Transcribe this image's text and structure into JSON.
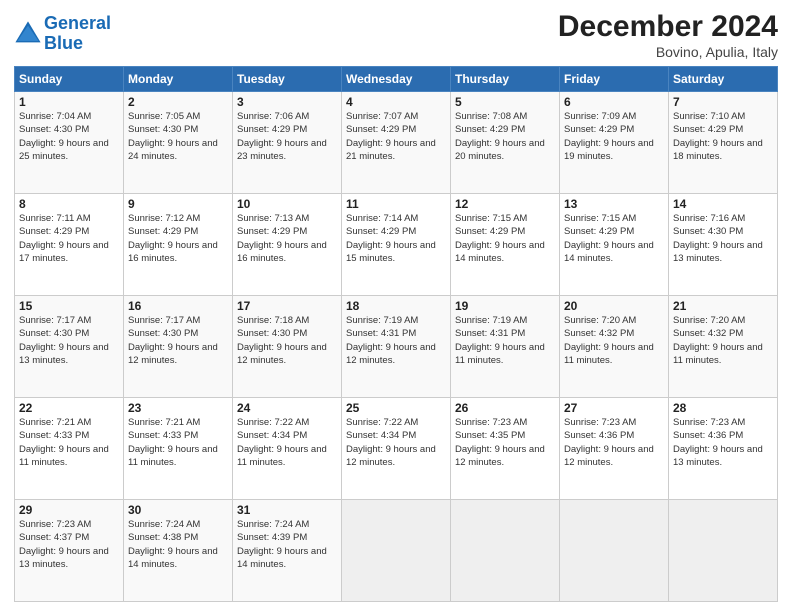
{
  "header": {
    "logo_line1": "General",
    "logo_line2": "Blue",
    "title": "December 2024",
    "subtitle": "Bovino, Apulia, Italy"
  },
  "calendar": {
    "headers": [
      "Sunday",
      "Monday",
      "Tuesday",
      "Wednesday",
      "Thursday",
      "Friday",
      "Saturday"
    ],
    "rows": [
      [
        {
          "day": "1",
          "rise": "7:04 AM",
          "set": "4:30 PM",
          "daylight": "9 hours and 25 minutes."
        },
        {
          "day": "2",
          "rise": "7:05 AM",
          "set": "4:30 PM",
          "daylight": "9 hours and 24 minutes."
        },
        {
          "day": "3",
          "rise": "7:06 AM",
          "set": "4:29 PM",
          "daylight": "9 hours and 23 minutes."
        },
        {
          "day": "4",
          "rise": "7:07 AM",
          "set": "4:29 PM",
          "daylight": "9 hours and 21 minutes."
        },
        {
          "day": "5",
          "rise": "7:08 AM",
          "set": "4:29 PM",
          "daylight": "9 hours and 20 minutes."
        },
        {
          "day": "6",
          "rise": "7:09 AM",
          "set": "4:29 PM",
          "daylight": "9 hours and 19 minutes."
        },
        {
          "day": "7",
          "rise": "7:10 AM",
          "set": "4:29 PM",
          "daylight": "9 hours and 18 minutes."
        }
      ],
      [
        {
          "day": "8",
          "rise": "7:11 AM",
          "set": "4:29 PM",
          "daylight": "9 hours and 17 minutes."
        },
        {
          "day": "9",
          "rise": "7:12 AM",
          "set": "4:29 PM",
          "daylight": "9 hours and 16 minutes."
        },
        {
          "day": "10",
          "rise": "7:13 AM",
          "set": "4:29 PM",
          "daylight": "9 hours and 16 minutes."
        },
        {
          "day": "11",
          "rise": "7:14 AM",
          "set": "4:29 PM",
          "daylight": "9 hours and 15 minutes."
        },
        {
          "day": "12",
          "rise": "7:15 AM",
          "set": "4:29 PM",
          "daylight": "9 hours and 14 minutes."
        },
        {
          "day": "13",
          "rise": "7:15 AM",
          "set": "4:29 PM",
          "daylight": "9 hours and 14 minutes."
        },
        {
          "day": "14",
          "rise": "7:16 AM",
          "set": "4:30 PM",
          "daylight": "9 hours and 13 minutes."
        }
      ],
      [
        {
          "day": "15",
          "rise": "7:17 AM",
          "set": "4:30 PM",
          "daylight": "9 hours and 13 minutes."
        },
        {
          "day": "16",
          "rise": "7:17 AM",
          "set": "4:30 PM",
          "daylight": "9 hours and 12 minutes."
        },
        {
          "day": "17",
          "rise": "7:18 AM",
          "set": "4:30 PM",
          "daylight": "9 hours and 12 minutes."
        },
        {
          "day": "18",
          "rise": "7:19 AM",
          "set": "4:31 PM",
          "daylight": "9 hours and 12 minutes."
        },
        {
          "day": "19",
          "rise": "7:19 AM",
          "set": "4:31 PM",
          "daylight": "9 hours and 11 minutes."
        },
        {
          "day": "20",
          "rise": "7:20 AM",
          "set": "4:32 PM",
          "daylight": "9 hours and 11 minutes."
        },
        {
          "day": "21",
          "rise": "7:20 AM",
          "set": "4:32 PM",
          "daylight": "9 hours and 11 minutes."
        }
      ],
      [
        {
          "day": "22",
          "rise": "7:21 AM",
          "set": "4:33 PM",
          "daylight": "9 hours and 11 minutes."
        },
        {
          "day": "23",
          "rise": "7:21 AM",
          "set": "4:33 PM",
          "daylight": "9 hours and 11 minutes."
        },
        {
          "day": "24",
          "rise": "7:22 AM",
          "set": "4:34 PM",
          "daylight": "9 hours and 11 minutes."
        },
        {
          "day": "25",
          "rise": "7:22 AM",
          "set": "4:34 PM",
          "daylight": "9 hours and 12 minutes."
        },
        {
          "day": "26",
          "rise": "7:23 AM",
          "set": "4:35 PM",
          "daylight": "9 hours and 12 minutes."
        },
        {
          "day": "27",
          "rise": "7:23 AM",
          "set": "4:36 PM",
          "daylight": "9 hours and 12 minutes."
        },
        {
          "day": "28",
          "rise": "7:23 AM",
          "set": "4:36 PM",
          "daylight": "9 hours and 13 minutes."
        }
      ],
      [
        {
          "day": "29",
          "rise": "7:23 AM",
          "set": "4:37 PM",
          "daylight": "9 hours and 13 minutes."
        },
        {
          "day": "30",
          "rise": "7:24 AM",
          "set": "4:38 PM",
          "daylight": "9 hours and 14 minutes."
        },
        {
          "day": "31",
          "rise": "7:24 AM",
          "set": "4:39 PM",
          "daylight": "9 hours and 14 minutes."
        },
        null,
        null,
        null,
        null
      ]
    ]
  },
  "labels": {
    "sunrise": "Sunrise:",
    "sunset": "Sunset:",
    "daylight": "Daylight:"
  }
}
